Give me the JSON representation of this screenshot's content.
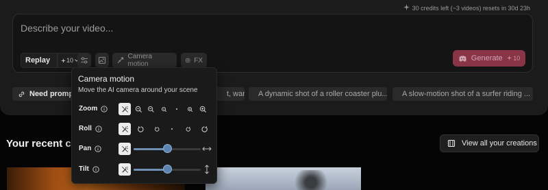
{
  "header": {
    "credits_text": "30 credits left (~3 videos) resets in 30d 23h"
  },
  "composer": {
    "placeholder": "Describe your video...",
    "model": {
      "name": "Replay",
      "cost": "10"
    },
    "camera_motion_label": "Camera motion",
    "fx_label": "FX",
    "generate": {
      "label": "Generate",
      "cost": "10"
    }
  },
  "suggestions": [
    {
      "label": "Need prompt",
      "icon": "link-icon"
    },
    {
      "label": "t, war...",
      "icon": "none"
    },
    {
      "label": "A dynamic shot of a roller coaster plu...",
      "icon": "sparkle-icon",
      "icon_color": "#e0577a"
    },
    {
      "label": "A slow-motion shot of a surfer riding ...",
      "icon": "sparkle-icon",
      "icon_color": "#e6a935"
    }
  ],
  "recent": {
    "title": "Your recent cr",
    "view_all_label": "View all your creations"
  },
  "camera_popup": {
    "title": "Camera motion",
    "description": "Move the AI camera around your scene",
    "rows": [
      {
        "label": "Zoom",
        "control": "steps",
        "steps": [
          "zoom-out-3",
          "zoom-out-2",
          "zoom-out-1",
          "none",
          "zoom-in-1",
          "zoom-in-2"
        ]
      },
      {
        "label": "Roll",
        "control": "steps",
        "steps": [
          "roll-ccw-2",
          "roll-ccw-1",
          "none",
          "roll-cw-1",
          "roll-cw-2"
        ]
      },
      {
        "label": "Pan",
        "control": "slider",
        "value": 0.5
      },
      {
        "label": "Tilt",
        "control": "slider",
        "value": 0.5
      }
    ]
  },
  "colors": {
    "accent": "#8a3448",
    "slider": "#5d84b0"
  }
}
